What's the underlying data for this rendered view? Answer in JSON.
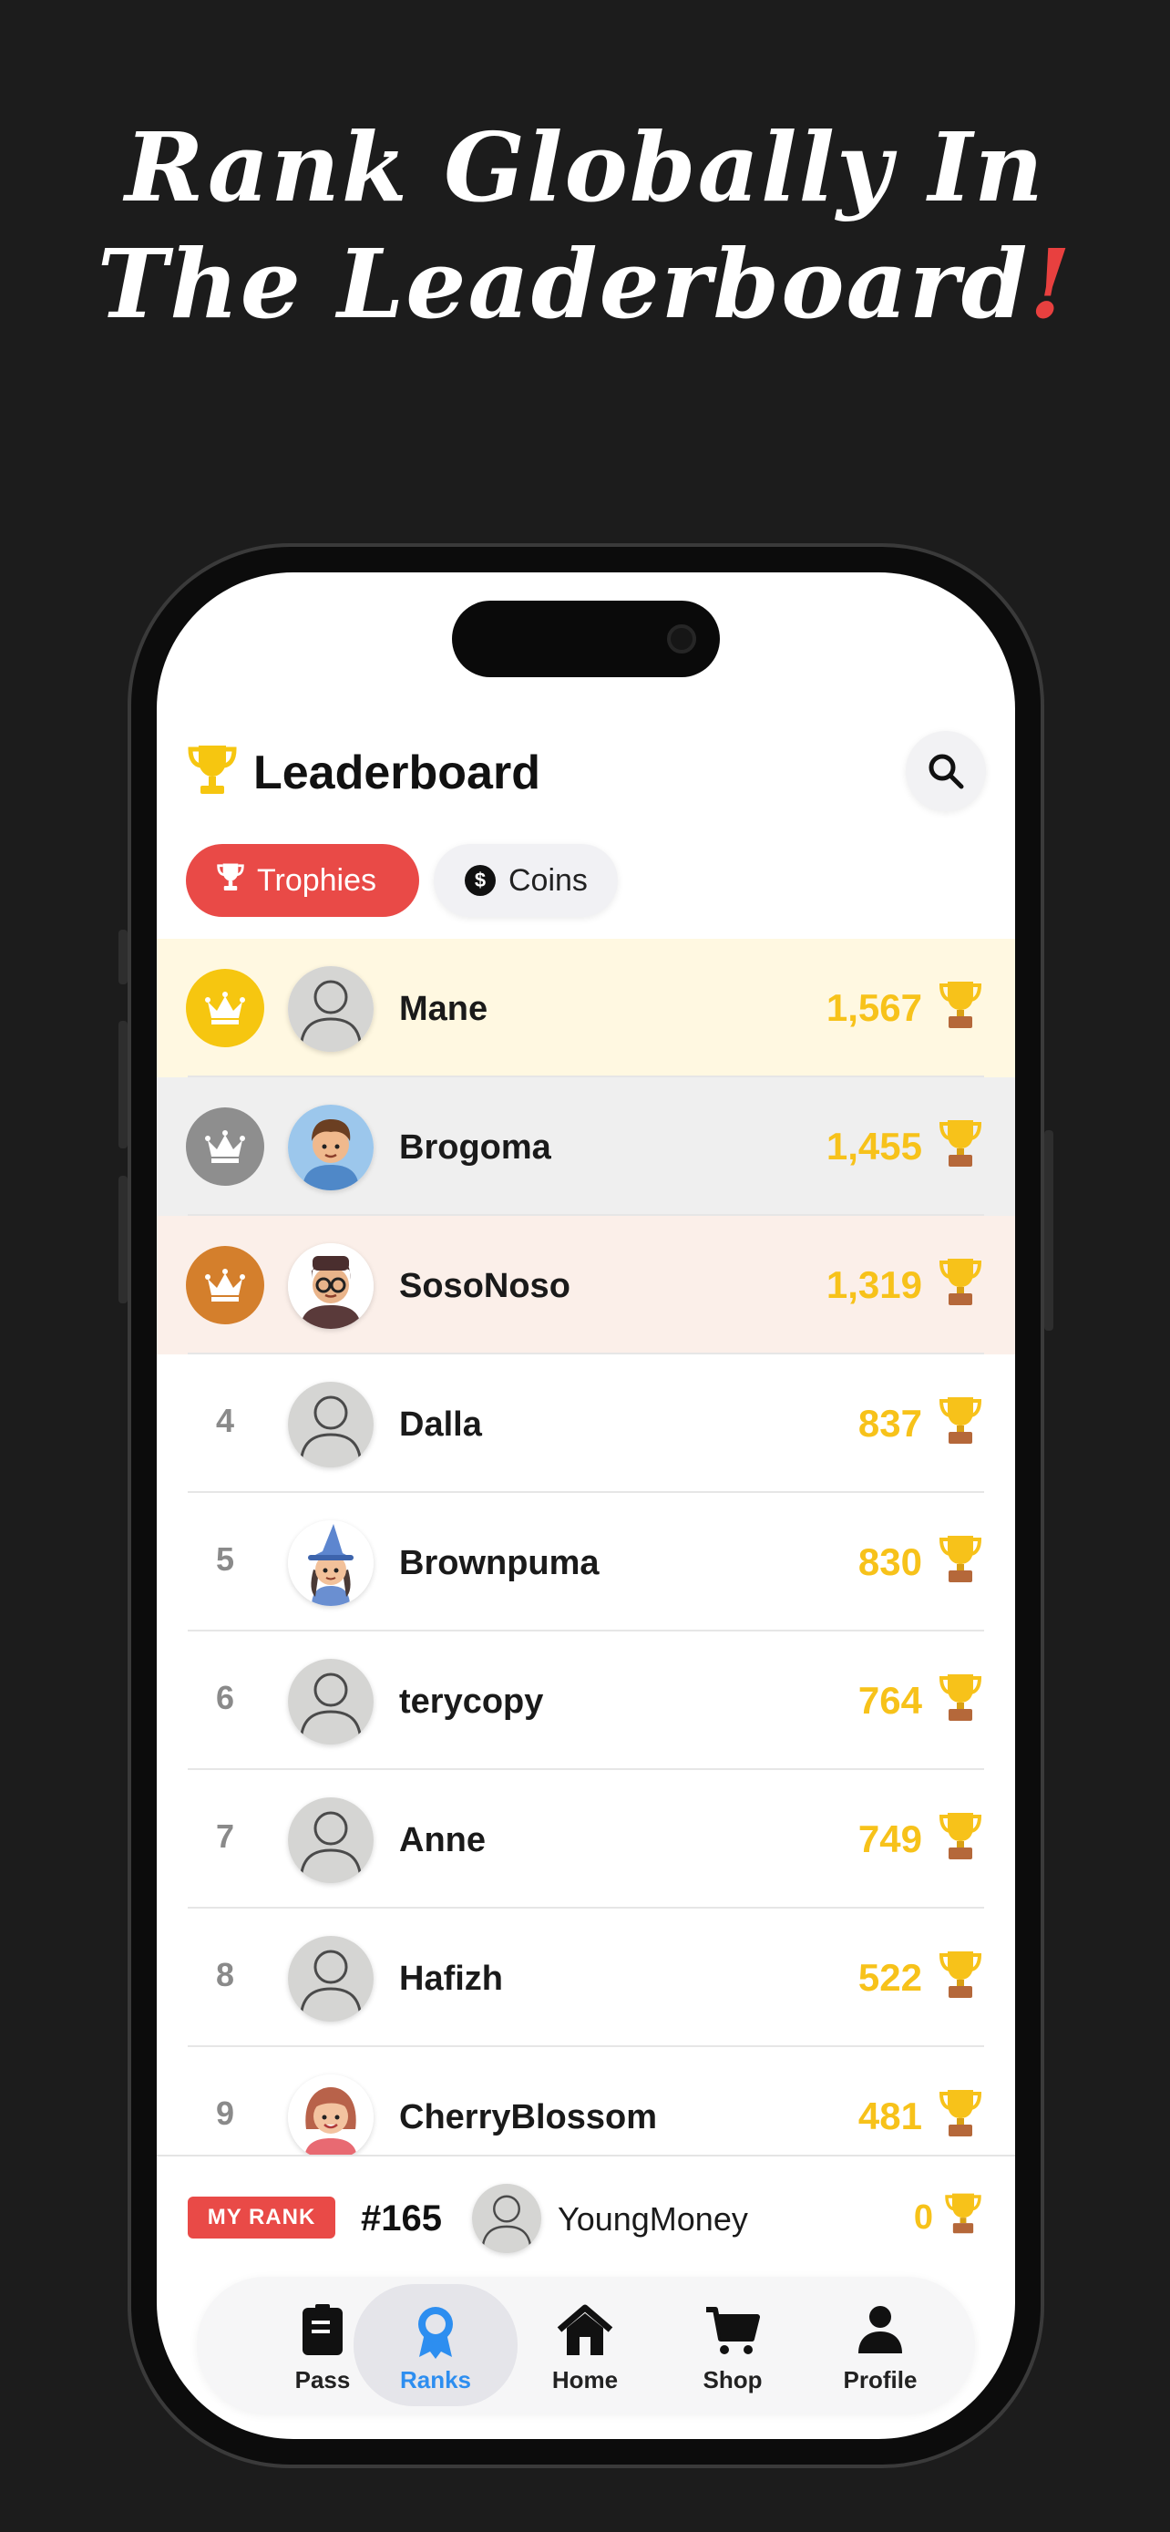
{
  "headline": {
    "line1": "Rank Globally In",
    "line2": "The Leaderboard",
    "exclaim": "!"
  },
  "header": {
    "title": "Leaderboard",
    "title_icon": "trophy-icon",
    "search_icon": "search-icon"
  },
  "tabs": [
    {
      "label": "Trophies",
      "icon": "trophy-icon",
      "active": true
    },
    {
      "label": "Coins",
      "icon": "coin-icon",
      "coin_symbol": "$",
      "active": false
    }
  ],
  "colors": {
    "accent": "#e94a47",
    "score": "#f7c21a",
    "gold": "#f6c610",
    "silver": "#8e8e8e",
    "bronze": "#d47f2c",
    "nav_active": "#2d8ef0"
  },
  "leaderboard": [
    {
      "rank": "1",
      "name": "Mane",
      "score": "1,567",
      "avatar": "default-avatar",
      "tier": "gold"
    },
    {
      "rank": "2",
      "name": "Brogoma",
      "score": "1,455",
      "avatar": "man-avatar",
      "tier": "silver"
    },
    {
      "rank": "3",
      "name": "SosoNoso",
      "score": "1,319",
      "avatar": "glasses-avatar",
      "tier": "bronze"
    },
    {
      "rank": "4",
      "name": "Dalla",
      "score": "837",
      "avatar": "default-avatar"
    },
    {
      "rank": "5",
      "name": "Brownpuma",
      "score": "830",
      "avatar": "witch-avatar"
    },
    {
      "rank": "6",
      "name": "terycopy",
      "score": "764",
      "avatar": "default-avatar"
    },
    {
      "rank": "7",
      "name": "Anne",
      "score": "749",
      "avatar": "default-avatar"
    },
    {
      "rank": "8",
      "name": "Hafizh",
      "score": "522",
      "avatar": "default-avatar"
    },
    {
      "rank": "9",
      "name": "CherryBlossom",
      "score": "481",
      "avatar": "girl-avatar"
    }
  ],
  "my_rank": {
    "tag": "MY RANK",
    "position": "#165",
    "name": "YoungMoney",
    "score": "0"
  },
  "nav": [
    {
      "label": "Pass",
      "icon": "pass-icon",
      "active": false
    },
    {
      "label": "Ranks",
      "icon": "ribbon-icon",
      "active": true
    },
    {
      "label": "Home",
      "icon": "home-icon",
      "active": false
    },
    {
      "label": "Shop",
      "icon": "cart-icon",
      "active": false
    },
    {
      "label": "Profile",
      "icon": "profile-icon",
      "active": false
    }
  ]
}
